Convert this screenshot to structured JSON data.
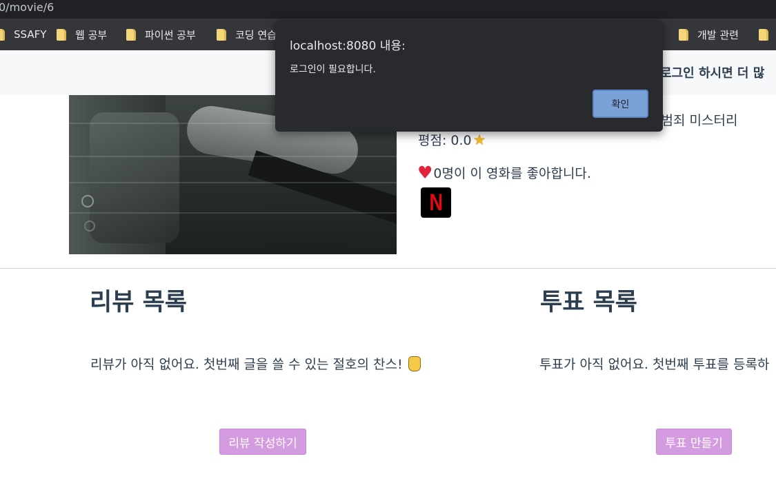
{
  "browser": {
    "url_text": "0/movie/6",
    "bookmarks": [
      {
        "label": "SSAFY"
      },
      {
        "label": "웹 공부"
      },
      {
        "label": "파이썬 공부"
      },
      {
        "label": "코딩 연습"
      },
      {
        "label": "개발 관련"
      }
    ]
  },
  "header": {
    "login_hint": "로그인 하시면 더 많"
  },
  "movie": {
    "genres": "러 범죄 미스터리",
    "rating_label": "평점: 0.0",
    "likes_text": "0명이 이 영화를 좋아합니다.",
    "provider_letter": "N"
  },
  "reviews": {
    "title": "리뷰 목록",
    "empty_text": "리뷰가 아직 없어요. 첫번째 글을 쓸 수 있는 절호의 찬스!",
    "button_label": "리뷰 작성하기"
  },
  "votes": {
    "title": "투표 목록",
    "empty_text": "투표가 아직 없어요. 첫번째 투표를 등록하",
    "button_label": "투표 만들기"
  },
  "dialog": {
    "title": "localhost:8080 내용:",
    "message": "로그인이 필요합니다.",
    "ok_label": "확인"
  },
  "colors": {
    "accent_button": "#d59be0",
    "dialog_button": "#7ca1d8",
    "heart": "#e3223e"
  }
}
